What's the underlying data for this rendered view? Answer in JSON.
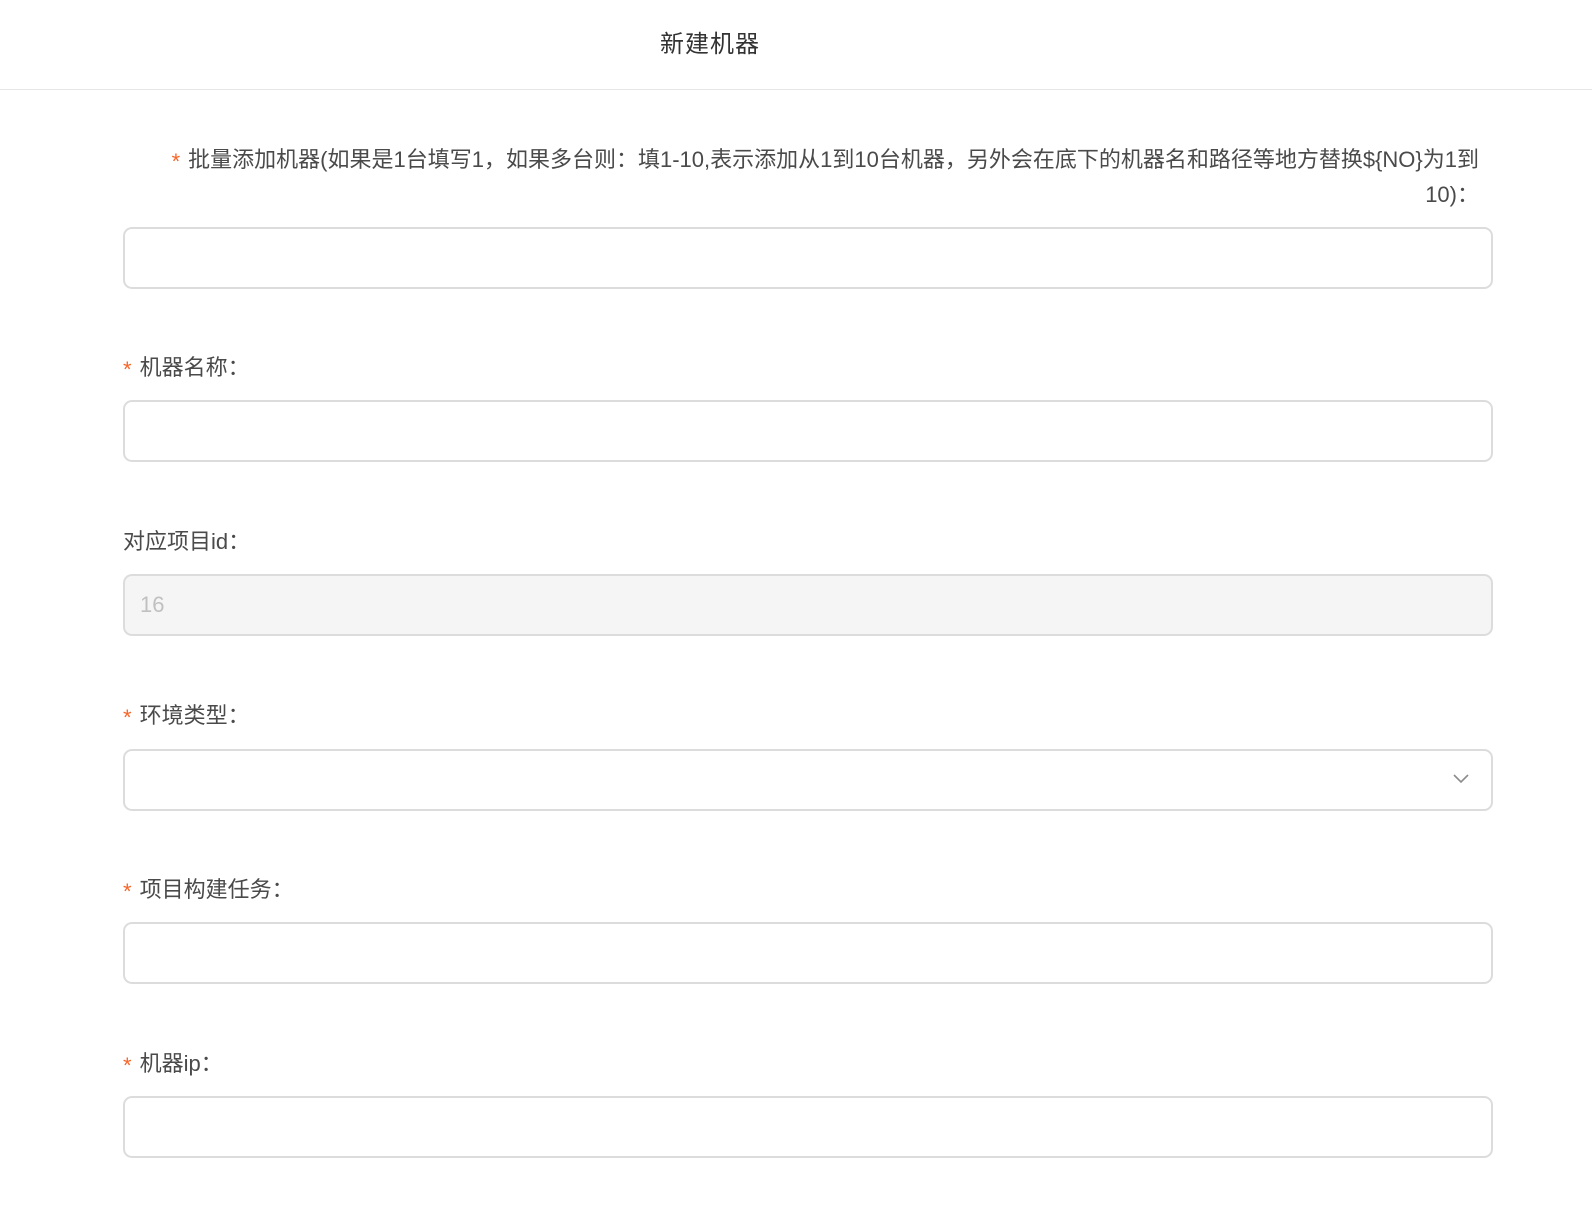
{
  "dialog": {
    "title": "新建机器"
  },
  "form": {
    "required_mark": "*",
    "batch": {
      "label": "批量添加机器(如果是1台填写1，如果多台则：填1-10,表示添加从1到10台机器，另外会在底下的机器名和路径等地方替换${NO}为1到10)：",
      "value": "",
      "required": true
    },
    "machine_name": {
      "label": "机器名称：",
      "value": "",
      "required": true
    },
    "project_id": {
      "label": "对应项目id：",
      "value": "16",
      "disabled": true,
      "required": false
    },
    "env_type": {
      "label": "环境类型：",
      "value": "",
      "required": true,
      "icon": "chevron-down-icon"
    },
    "build_task": {
      "label": "项目构建任务：",
      "value": "",
      "required": true
    },
    "machine_ip": {
      "label": "机器ip：",
      "value": "",
      "required": true
    }
  },
  "colors": {
    "required": "#f5662b",
    "border": "#dcdcdc",
    "disabled_bg": "#f5f5f5"
  }
}
